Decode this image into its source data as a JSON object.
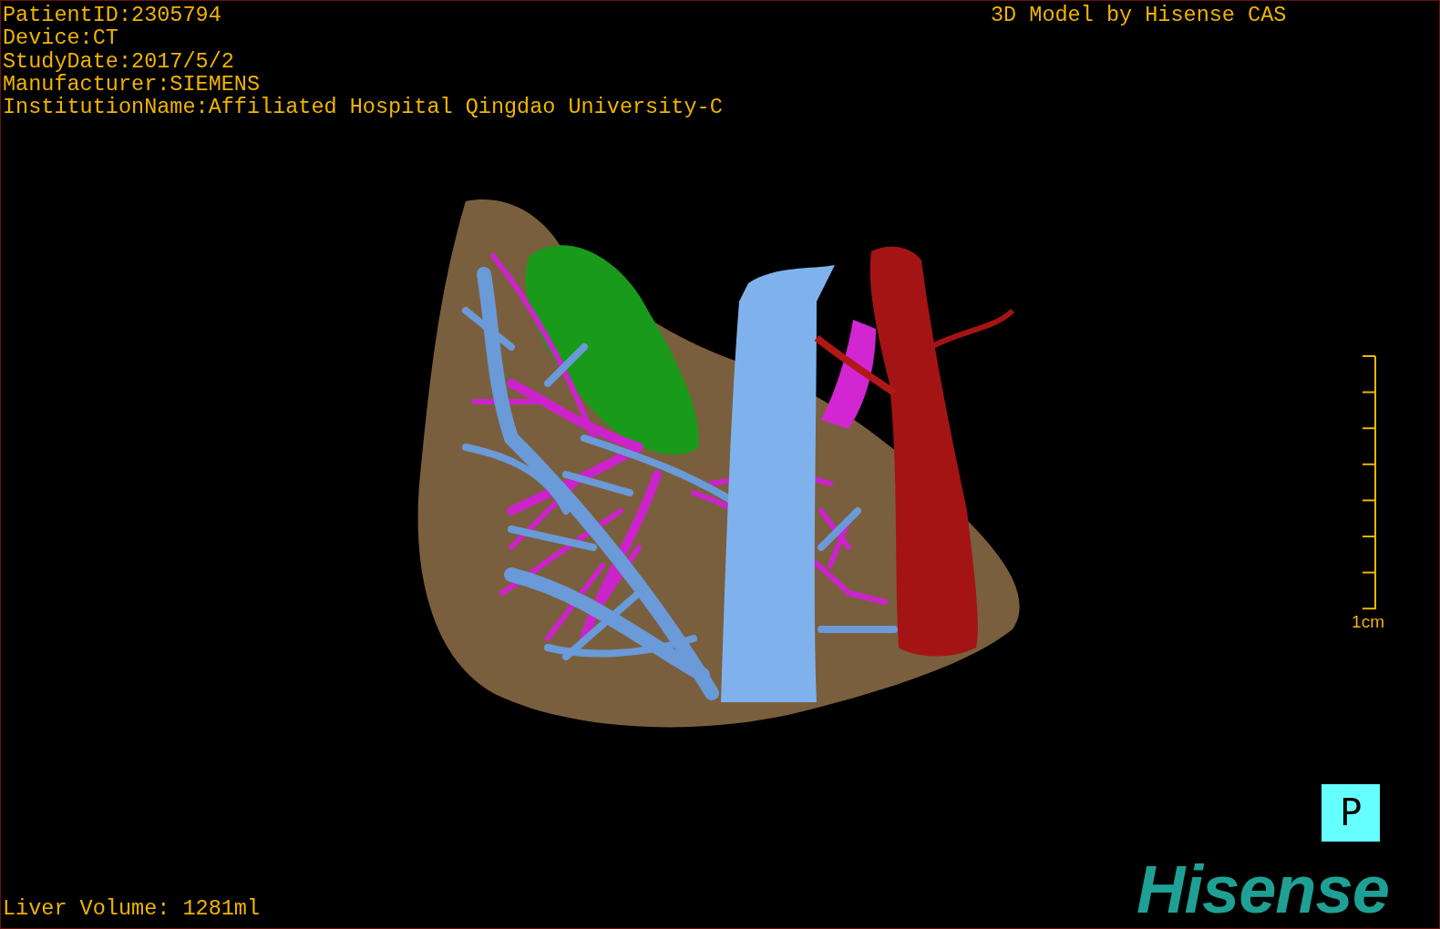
{
  "info_lines": [
    "PatientID:2305794",
    "Device:CT",
    "StudyDate:2017/5/2",
    "Manufacturer:SIEMENS",
    "InstitutionName:Affiliated Hospital Qingdao University-C"
  ],
  "credit": "3D Model by Hisense CAS",
  "scale_bar": {
    "label": "1cm"
  },
  "orientation_marker": "P",
  "logo": "Hisense",
  "liver_volume": "Liver Volume: 1281ml"
}
